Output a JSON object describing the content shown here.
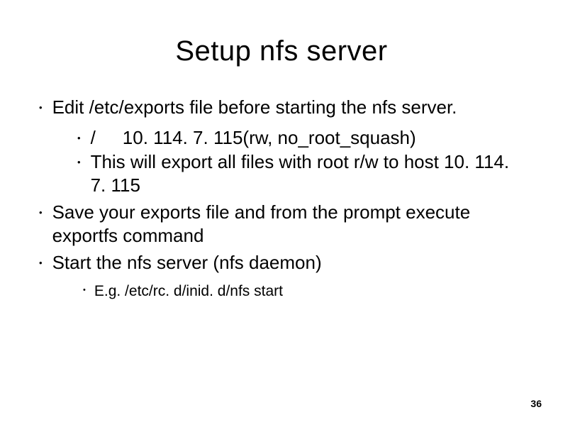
{
  "title": "Setup nfs server",
  "bullets": {
    "b1": "Edit /etc/exports file before starting the nfs server.",
    "b1a_pre": "/",
    "b1a_post": "10. 114. 7. 115(rw, no_root_squash)",
    "b1b": "This will export all files with root r/w to host 10. 114. 7. 115",
    "b2": "Save your exports file and from the prompt execute exportfs command",
    "b3": "Start the nfs server (nfs daemon)",
    "b3a": "E.g. /etc/rc. d/inid. d/nfs start"
  },
  "page_number": "36",
  "glyph": "•"
}
